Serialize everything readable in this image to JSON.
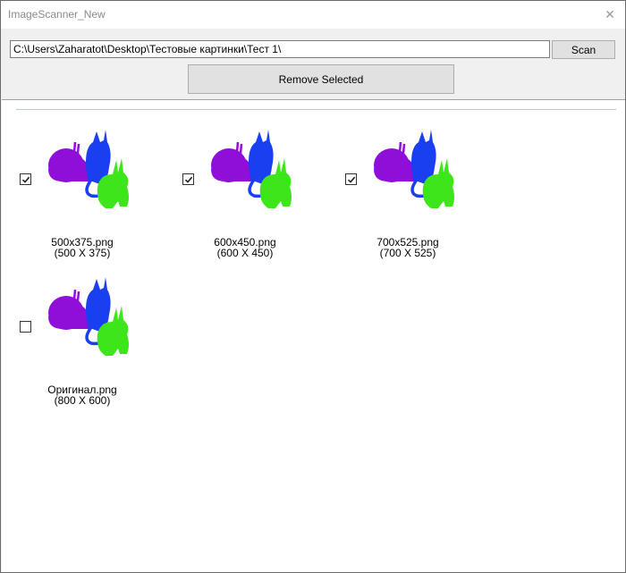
{
  "window": {
    "title": "ImageScanner_New",
    "close_symbol": "✕"
  },
  "toolbar": {
    "path_value": "C:\\Users\\Zaharatot\\Desktop\\Тестовые картинки\\Тест 1\\",
    "scan_label": "Scan",
    "remove_label": "Remove Selected"
  },
  "images": [
    {
      "name": "500x375.png",
      "dims": "(500 X 375)",
      "checked": true
    },
    {
      "name": "600x450.png",
      "dims": "(600 X 450)",
      "checked": true
    },
    {
      "name": "700x525.png",
      "dims": "(700 X 525)",
      "checked": true
    },
    {
      "name": "Оригинал.png",
      "dims": "(800 X 600)",
      "checked": false
    }
  ],
  "colors": {
    "snail": "#8f0fd8",
    "cat": "#1a3ff0",
    "rabbit": "#3ce61a"
  }
}
